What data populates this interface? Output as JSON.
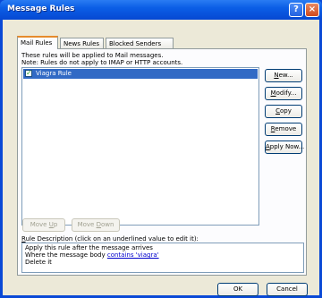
{
  "window": {
    "title": "Message Rules",
    "help_glyph": "?",
    "close_glyph": "×"
  },
  "tabs": [
    {
      "label": "Mail Rules",
      "active": true
    },
    {
      "label": "News Rules",
      "active": false
    },
    {
      "label": "Blocked Senders",
      "active": false
    }
  ],
  "info": {
    "line1": "These rules will be applied to Mail messages.",
    "line2": "Note: Rules do not apply to IMAP or HTTP accounts."
  },
  "rules": [
    {
      "label": "Viagra Rule",
      "checked": true,
      "check_glyph": "✓"
    }
  ],
  "side_buttons": {
    "new": {
      "accel": "N",
      "rest": "ew..."
    },
    "modify": {
      "accel": "M",
      "rest": "odify..."
    },
    "copy": {
      "accel": "C",
      "rest": "opy"
    },
    "remove": {
      "accel": "R",
      "rest": "emove"
    },
    "apply_now": {
      "accel": "A",
      "rest": "pply Now..."
    }
  },
  "move_buttons": {
    "up": {
      "pre": "Move ",
      "accel": "U",
      "rest": "p"
    },
    "down": {
      "pre": "Move ",
      "accel": "D",
      "rest": "own"
    }
  },
  "description": {
    "label_accel": "R",
    "label_rest": "ule Description (click on an underlined value to edit it):",
    "line1": "Apply this rule after the message arrives",
    "line2_prefix": "Where the message body ",
    "line2_link": "contains 'viagra'",
    "line3": "Delete it"
  },
  "footer": {
    "ok": "OK",
    "cancel": "Cancel"
  }
}
